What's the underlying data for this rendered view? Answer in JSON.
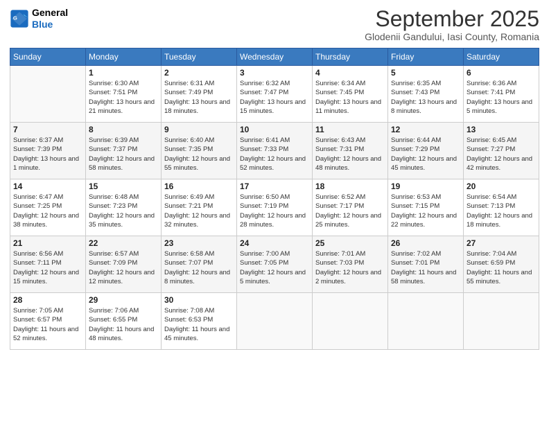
{
  "header": {
    "logo_general": "General",
    "logo_blue": "Blue",
    "month": "September 2025",
    "location": "Glodenii Gandului, Iasi County, Romania"
  },
  "days_of_week": [
    "Sunday",
    "Monday",
    "Tuesday",
    "Wednesday",
    "Thursday",
    "Friday",
    "Saturday"
  ],
  "weeks": [
    [
      {
        "day": null
      },
      {
        "day": 1,
        "sunrise": "6:30 AM",
        "sunset": "7:51 PM",
        "daylight": "13 hours and 21 minutes."
      },
      {
        "day": 2,
        "sunrise": "6:31 AM",
        "sunset": "7:49 PM",
        "daylight": "13 hours and 18 minutes."
      },
      {
        "day": 3,
        "sunrise": "6:32 AM",
        "sunset": "7:47 PM",
        "daylight": "13 hours and 15 minutes."
      },
      {
        "day": 4,
        "sunrise": "6:34 AM",
        "sunset": "7:45 PM",
        "daylight": "13 hours and 11 minutes."
      },
      {
        "day": 5,
        "sunrise": "6:35 AM",
        "sunset": "7:43 PM",
        "daylight": "13 hours and 8 minutes."
      },
      {
        "day": 6,
        "sunrise": "6:36 AM",
        "sunset": "7:41 PM",
        "daylight": "13 hours and 5 minutes."
      }
    ],
    [
      {
        "day": 7,
        "sunrise": "6:37 AM",
        "sunset": "7:39 PM",
        "daylight": "13 hours and 1 minute."
      },
      {
        "day": 8,
        "sunrise": "6:39 AM",
        "sunset": "7:37 PM",
        "daylight": "12 hours and 58 minutes."
      },
      {
        "day": 9,
        "sunrise": "6:40 AM",
        "sunset": "7:35 PM",
        "daylight": "12 hours and 55 minutes."
      },
      {
        "day": 10,
        "sunrise": "6:41 AM",
        "sunset": "7:33 PM",
        "daylight": "12 hours and 52 minutes."
      },
      {
        "day": 11,
        "sunrise": "6:43 AM",
        "sunset": "7:31 PM",
        "daylight": "12 hours and 48 minutes."
      },
      {
        "day": 12,
        "sunrise": "6:44 AM",
        "sunset": "7:29 PM",
        "daylight": "12 hours and 45 minutes."
      },
      {
        "day": 13,
        "sunrise": "6:45 AM",
        "sunset": "7:27 PM",
        "daylight": "12 hours and 42 minutes."
      }
    ],
    [
      {
        "day": 14,
        "sunrise": "6:47 AM",
        "sunset": "7:25 PM",
        "daylight": "12 hours and 38 minutes."
      },
      {
        "day": 15,
        "sunrise": "6:48 AM",
        "sunset": "7:23 PM",
        "daylight": "12 hours and 35 minutes."
      },
      {
        "day": 16,
        "sunrise": "6:49 AM",
        "sunset": "7:21 PM",
        "daylight": "12 hours and 32 minutes."
      },
      {
        "day": 17,
        "sunrise": "6:50 AM",
        "sunset": "7:19 PM",
        "daylight": "12 hours and 28 minutes."
      },
      {
        "day": 18,
        "sunrise": "6:52 AM",
        "sunset": "7:17 PM",
        "daylight": "12 hours and 25 minutes."
      },
      {
        "day": 19,
        "sunrise": "6:53 AM",
        "sunset": "7:15 PM",
        "daylight": "12 hours and 22 minutes."
      },
      {
        "day": 20,
        "sunrise": "6:54 AM",
        "sunset": "7:13 PM",
        "daylight": "12 hours and 18 minutes."
      }
    ],
    [
      {
        "day": 21,
        "sunrise": "6:56 AM",
        "sunset": "7:11 PM",
        "daylight": "12 hours and 15 minutes."
      },
      {
        "day": 22,
        "sunrise": "6:57 AM",
        "sunset": "7:09 PM",
        "daylight": "12 hours and 12 minutes."
      },
      {
        "day": 23,
        "sunrise": "6:58 AM",
        "sunset": "7:07 PM",
        "daylight": "12 hours and 8 minutes."
      },
      {
        "day": 24,
        "sunrise": "7:00 AM",
        "sunset": "7:05 PM",
        "daylight": "12 hours and 5 minutes."
      },
      {
        "day": 25,
        "sunrise": "7:01 AM",
        "sunset": "7:03 PM",
        "daylight": "12 hours and 2 minutes."
      },
      {
        "day": 26,
        "sunrise": "7:02 AM",
        "sunset": "7:01 PM",
        "daylight": "11 hours and 58 minutes."
      },
      {
        "day": 27,
        "sunrise": "7:04 AM",
        "sunset": "6:59 PM",
        "daylight": "11 hours and 55 minutes."
      }
    ],
    [
      {
        "day": 28,
        "sunrise": "7:05 AM",
        "sunset": "6:57 PM",
        "daylight": "11 hours and 52 minutes."
      },
      {
        "day": 29,
        "sunrise": "7:06 AM",
        "sunset": "6:55 PM",
        "daylight": "11 hours and 48 minutes."
      },
      {
        "day": 30,
        "sunrise": "7:08 AM",
        "sunset": "6:53 PM",
        "daylight": "11 hours and 45 minutes."
      },
      {
        "day": null
      },
      {
        "day": null
      },
      {
        "day": null
      },
      {
        "day": null
      }
    ]
  ]
}
